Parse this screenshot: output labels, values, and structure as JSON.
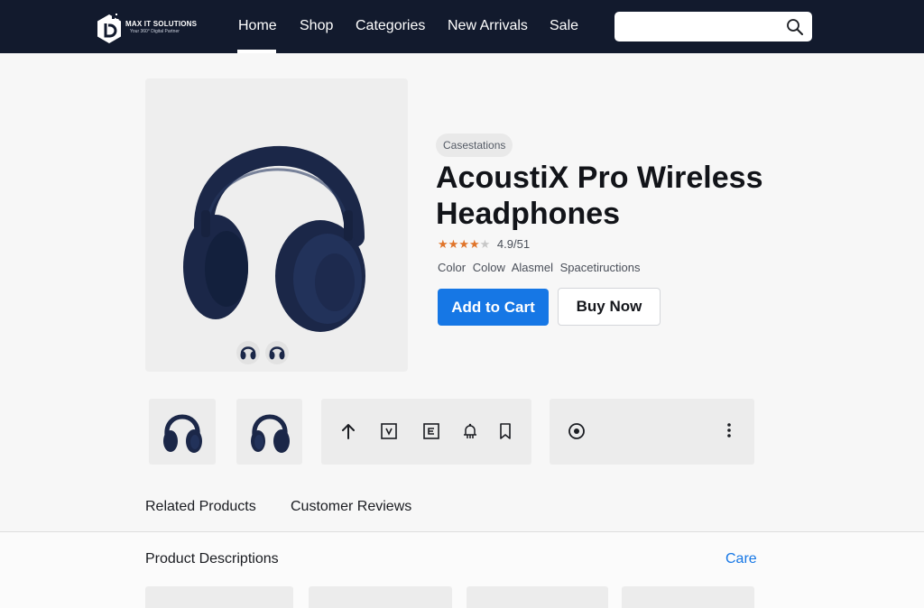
{
  "brand": {
    "name": "MAX IT SOLUTIONS",
    "tagline": "Your 360° Digital Partner",
    "logo_icon": "hexagon-logo-icon"
  },
  "nav": {
    "items": [
      {
        "label": "Home",
        "active": true
      },
      {
        "label": "Shop",
        "active": false
      },
      {
        "label": "Categories",
        "active": false
      },
      {
        "label": "New Arrivals",
        "active": false
      },
      {
        "label": "Sale",
        "active": false
      }
    ],
    "search": {
      "value": "",
      "placeholder": "",
      "icon": "search-icon"
    }
  },
  "product": {
    "badge": "Casestations",
    "title": "AcoustiX Pro Wireless Headphones",
    "rating_value": 4,
    "rating_max": 5,
    "rating_text": "4.9/51",
    "options": [
      "Color",
      "Colow",
      "Alasmel",
      "Spacetiructions"
    ],
    "add_to_cart_label": "Add to Cart",
    "buy_now_label": "Buy Now"
  },
  "toolbar": {
    "icons": [
      "arrow-up-icon",
      "dropdown-box-icon",
      "e-box-icon",
      "bell-icon",
      "bookmark-icon"
    ],
    "extra_icons": [
      "radio-target-icon",
      "more-vertical-icon"
    ]
  },
  "tabs": [
    {
      "label": "Related Products"
    },
    {
      "label": "Customer Reviews"
    }
  ],
  "section": {
    "title": "Product Descriptions",
    "link_label": "Care"
  },
  "colors": {
    "nav_bg": "#121a2d",
    "accent": "#1677e5",
    "star": "#e0742a",
    "product_navy": "#1b2748"
  }
}
